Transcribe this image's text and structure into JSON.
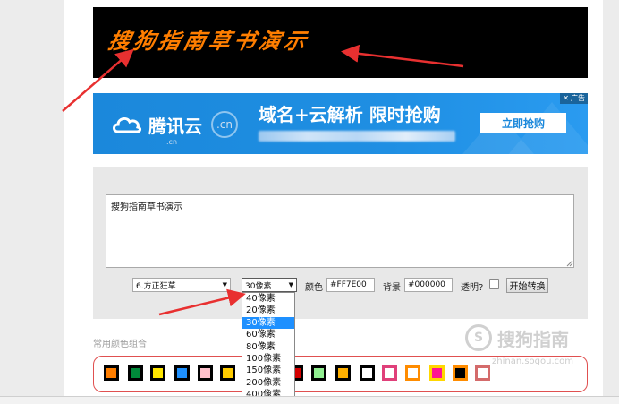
{
  "banner": {
    "text": "搜狗指南草书演示",
    "color": "#FF7E00"
  },
  "ad": {
    "brand": "腾讯云",
    "cn_circle": ".cn",
    "cn_small": ".cn",
    "headline": "域名+云解析 限时抢购",
    "cta": "立即抢购",
    "badge": "广告"
  },
  "form": {
    "textarea_value": "搜狗指南草书演示",
    "font_select": "6.方正狂草",
    "size_select": "30像素",
    "color_label": "颜色",
    "color_value": "#FF7E00",
    "bg_label": "背景",
    "bg_value": "#000000",
    "transparent_label": "透明?",
    "convert_button": "开始转换"
  },
  "size_options": [
    "40像素",
    "20像素",
    "30像素",
    "60像素",
    "80像素",
    "100像素",
    "150像素",
    "200像素",
    "400像素"
  ],
  "size_selected_index": 2,
  "palette": {
    "title": "常用颜色组合",
    "swatches": [
      {
        "fill": "#ff7e00",
        "border": "#000000"
      },
      {
        "fill": "#008a3a",
        "border": "#000000"
      },
      {
        "fill": "#ffe600",
        "border": "#000000"
      },
      {
        "fill": "#1e90ff",
        "border": "#000000"
      },
      {
        "fill": "#ffc0cb",
        "border": "#000000"
      },
      {
        "fill": "#ffcc00",
        "border": "#000000"
      },
      {
        "fill": "#d40000",
        "border": "#000000"
      },
      {
        "fill": "#90ee90",
        "border": "#000000"
      },
      {
        "fill": "#ffb000",
        "border": "#000000"
      },
      {
        "fill": "#ffffff",
        "border": "#000000"
      },
      {
        "fill": "#ffffff",
        "border": "#e0407a"
      },
      {
        "fill": "#ffffff",
        "border": "#ff8c00"
      },
      {
        "fill": "#ff1493",
        "border": "#ffd700"
      },
      {
        "fill": "#000000",
        "border": "#ff8c00"
      },
      {
        "fill": "#ffffff",
        "border": "#d46b6b"
      }
    ]
  },
  "watermark": {
    "brand": "搜狗指南",
    "url": "zhinan.sogou.com"
  },
  "colors": {
    "arrow": "#e83030",
    "accent": "#1e90ff"
  }
}
